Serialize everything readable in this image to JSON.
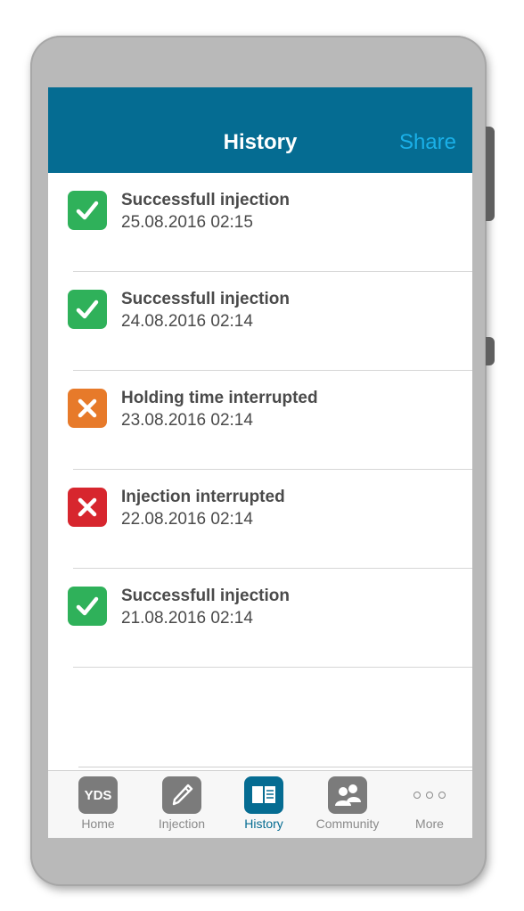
{
  "header": {
    "title": "History",
    "share_label": "Share"
  },
  "colors": {
    "navbar": "#056c92",
    "share": "#1ab0e8",
    "success": "#2fb15a",
    "warning": "#e77a2a",
    "error": "#d7262e",
    "tab_active": "#056c92",
    "tab_inactive": "#7b7b7b"
  },
  "history": [
    {
      "status": "success",
      "icon": "check-icon",
      "title": "Successfull injection",
      "date": "25.08.2016 02:15"
    },
    {
      "status": "success",
      "icon": "check-icon",
      "title": "Successfull injection",
      "date": "24.08.2016 02:14"
    },
    {
      "status": "warning",
      "icon": "x-icon",
      "title": "Holding time interrupted",
      "date": "23.08.2016 02:14"
    },
    {
      "status": "error",
      "icon": "x-icon",
      "title": "Injection interrupted",
      "date": "22.08.2016 02:14"
    },
    {
      "status": "success",
      "icon": "check-icon",
      "title": "Successfull injection",
      "date": "21.08.2016 02:14"
    }
  ],
  "tabs": [
    {
      "label": "Home",
      "icon": "yds-logo-icon",
      "icon_text": "YDS",
      "active": false
    },
    {
      "label": "Injection",
      "icon": "pen-icon",
      "active": false
    },
    {
      "label": "History",
      "icon": "book-icon",
      "active": true
    },
    {
      "label": "Community",
      "icon": "people-icon",
      "active": false
    },
    {
      "label": "More",
      "icon": "more-dots-icon",
      "active": false
    }
  ]
}
